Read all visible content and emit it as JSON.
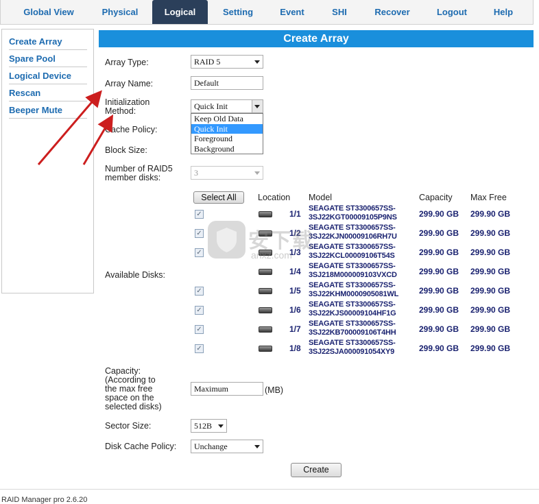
{
  "nav": {
    "tabs": [
      {
        "label": "Global View"
      },
      {
        "label": "Physical"
      },
      {
        "label": "Logical"
      },
      {
        "label": "Setting"
      },
      {
        "label": "Event"
      },
      {
        "label": "SHI"
      },
      {
        "label": "Recover"
      },
      {
        "label": "Logout"
      },
      {
        "label": "Help"
      }
    ],
    "active": "Logical"
  },
  "sidebar": {
    "items": [
      {
        "label": "Create Array"
      },
      {
        "label": "Spare Pool"
      },
      {
        "label": "Logical Device"
      },
      {
        "label": "Rescan"
      },
      {
        "label": "Beeper Mute"
      }
    ]
  },
  "form": {
    "title": "Create Array",
    "array_type": {
      "label": "Array Type:",
      "value": "RAID 5"
    },
    "array_name": {
      "label": "Array Name:",
      "value": "Default"
    },
    "init_method": {
      "label_line1": "Initialization",
      "label_line2": "Method:",
      "value": "Quick Init",
      "options": [
        "Keep Old Data",
        "Quick Init",
        "Foreground",
        "Background"
      ]
    },
    "cache_policy": {
      "label": "Cache Policy:"
    },
    "block_size": {
      "label": "Block Size:"
    },
    "member_disks": {
      "label_line1": "Number of RAID5",
      "label_line2": "member disks:",
      "value": "3"
    },
    "available_disks": {
      "label": "Available Disks:"
    },
    "select_all_label": "Select All",
    "columns": {
      "location": "Location",
      "model": "Model",
      "capacity": "Capacity",
      "max_free": "Max Free"
    },
    "disks": [
      {
        "location": "1/1",
        "model_line1": "SEAGATE ST3300657SS-",
        "model_line2": "3SJ22KGT00009105P9NS",
        "capacity": "299.90 GB",
        "max_free": "299.90 GB"
      },
      {
        "location": "1/2",
        "model_line1": "SEAGATE ST3300657SS-",
        "model_line2": "3SJ22KJN00009106RH7U",
        "capacity": "299.90 GB",
        "max_free": "299.90 GB"
      },
      {
        "location": "1/3",
        "model_line1": "SEAGATE ST3300657SS-",
        "model_line2": "3SJ22KCL00009106T54S",
        "capacity": "299.90 GB",
        "max_free": "299.90 GB"
      },
      {
        "location": "1/4",
        "model_line1": "SEAGATE ST3300657SS-",
        "model_line2": "3SJ218M000009103VXCD",
        "capacity": "299.90 GB",
        "max_free": "299.90 GB"
      },
      {
        "location": "1/5",
        "model_line1": "SEAGATE ST3300657SS-",
        "model_line2": "3SJ22KHM0000905081WL",
        "capacity": "299.90 GB",
        "max_free": "299.90 GB"
      },
      {
        "location": "1/6",
        "model_line1": "SEAGATE ST3300657SS-",
        "model_line2": "3SJ22KJS00009104HF1G",
        "capacity": "299.90 GB",
        "max_free": "299.90 GB"
      },
      {
        "location": "1/7",
        "model_line1": "SEAGATE ST3300657SS-",
        "model_line2": "3SJ22KB700009106T4HH",
        "capacity": "299.90 GB",
        "max_free": "299.90 GB"
      },
      {
        "location": "1/8",
        "model_line1": "SEAGATE ST3300657SS-",
        "model_line2": "3SJ22SJA000091054XY9",
        "capacity": "299.90 GB",
        "max_free": "299.90 GB"
      }
    ],
    "capacity": {
      "label_lines": [
        "Capacity:",
        "(According to",
        "the max free",
        "space on the",
        "selected disks)"
      ],
      "value": "Maximum",
      "unit": "(MB)"
    },
    "sector_size": {
      "label": "Sector Size:",
      "value": "512B"
    },
    "disk_cache_policy": {
      "label": "Disk Cache Policy:",
      "value": "Unchange"
    },
    "create_label": "Create"
  },
  "watermark": {
    "text": "安下载",
    "subtext": "anxz.com"
  },
  "footer": {
    "text": "RAID Manager pro 2.6.20"
  },
  "colors": {
    "nav_active_bg": "#2b3f5a",
    "header_bg": "#1a8fdc",
    "link": "#1d6bb0",
    "data_text": "#1a2270",
    "arrow": "#cc1e1e"
  }
}
